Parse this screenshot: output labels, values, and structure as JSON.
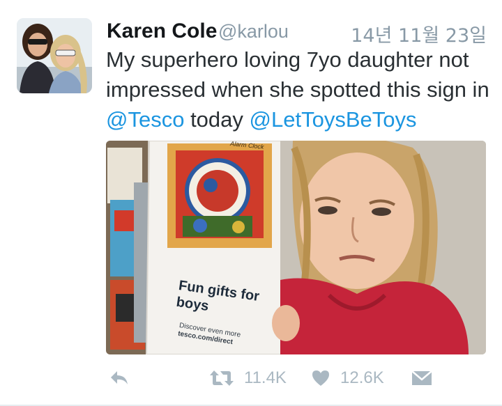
{
  "tweet": {
    "display_name": "Karen Cole",
    "handle": "@karlou",
    "timestamp": "14년 11월 23일",
    "text_segments": [
      {
        "text": "My superhero loving 7yo daughter not impressed when she spotted this sign in ",
        "type": "plain"
      },
      {
        "text": "@Tesco",
        "type": "mention"
      },
      {
        "text": " today ",
        "type": "plain"
      },
      {
        "text": "@LetToysBeToys",
        "type": "mention"
      }
    ],
    "media": {
      "sign_heading": "Fun gifts for boys",
      "sign_subtext": "Discover even more",
      "sign_url": "tesco.com/direct",
      "clock_label": "Alarm Clock"
    },
    "actions": {
      "reply_icon": "reply-icon",
      "retweet_icon": "retweet-icon",
      "retweet_count": "11.4K",
      "like_icon": "heart-icon",
      "like_count": "12.6K",
      "message_icon": "envelope-icon"
    }
  },
  "colors": {
    "mention": "#1b95e0",
    "muted": "#8899a6",
    "action_gray": "#aab8c2",
    "text": "#292f33"
  }
}
